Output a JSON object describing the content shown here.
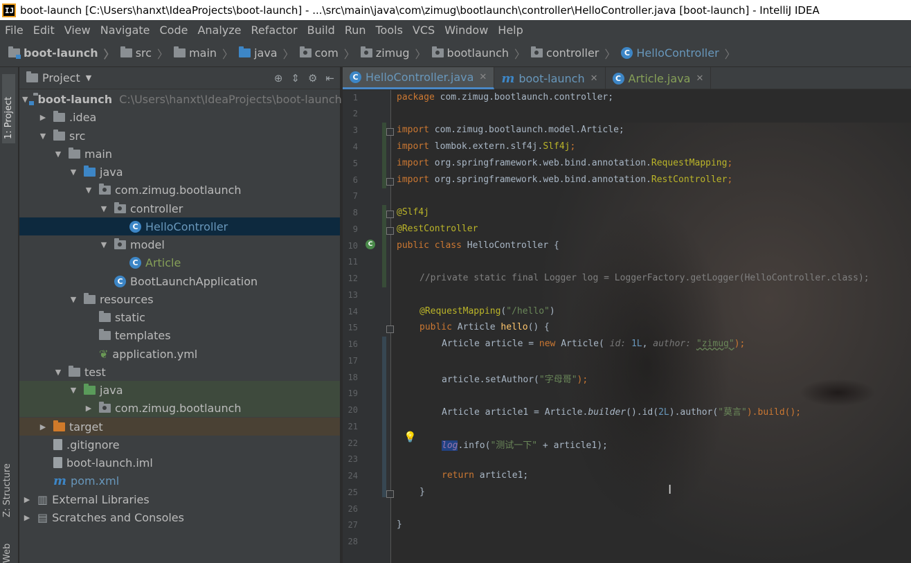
{
  "window": {
    "title": "boot-launch [C:\\Users\\hanxt\\IdeaProjects\\boot-launch] - ...\\src\\main\\java\\com\\zimug\\bootlaunch\\controller\\HelloController.java [boot-launch] - IntelliJ IDEA",
    "app_icon": "IJ"
  },
  "menu": [
    "File",
    "Edit",
    "View",
    "Navigate",
    "Code",
    "Analyze",
    "Refactor",
    "Build",
    "Run",
    "Tools",
    "VCS",
    "Window",
    "Help"
  ],
  "breadcrumb": [
    "boot-launch",
    "src",
    "main",
    "java",
    "com",
    "zimug",
    "bootlaunch",
    "controller",
    "HelloController"
  ],
  "tool_windows": {
    "project_tab": "1: Project",
    "structure_tab": "Z: Structure",
    "web_tab": "Web"
  },
  "project_panel": {
    "title": "Project",
    "tree": [
      {
        "label": "boot-launch",
        "path": "C:\\Users\\hanxt\\IdeaProjects\\boot-launch"
      },
      {
        "label": ".idea"
      },
      {
        "label": "src"
      },
      {
        "label": "main"
      },
      {
        "label": "java"
      },
      {
        "label": "com.zimug.bootlaunch"
      },
      {
        "label": "controller"
      },
      {
        "label": "HelloController"
      },
      {
        "label": "model"
      },
      {
        "label": "Article"
      },
      {
        "label": "BootLaunchApplication"
      },
      {
        "label": "resources"
      },
      {
        "label": "static"
      },
      {
        "label": "templates"
      },
      {
        "label": "application.yml"
      },
      {
        "label": "test"
      },
      {
        "label": "java"
      },
      {
        "label": "com.zimug.bootlaunch"
      },
      {
        "label": "target"
      },
      {
        "label": ".gitignore"
      },
      {
        "label": "boot-launch.iml"
      },
      {
        "label": "pom.xml"
      },
      {
        "label": "External Libraries"
      },
      {
        "label": "Scratches and Consoles"
      }
    ]
  },
  "editor_tabs": [
    {
      "label": "HelloController.java",
      "active": true
    },
    {
      "label": "boot-launch",
      "active": false
    },
    {
      "label": "Article.java",
      "active": false
    }
  ],
  "line_numbers": [
    "1",
    "2",
    "3",
    "4",
    "5",
    "6",
    "7",
    "8",
    "9",
    "10",
    "11",
    "12",
    "13",
    "14",
    "15",
    "16",
    "17",
    "18",
    "19",
    "20",
    "21",
    "22",
    "23",
    "24",
    "25",
    "26",
    "27",
    "28"
  ],
  "code": {
    "l1_kw": "package",
    "l1_rest": " com.zimug.bootlaunch.controller;",
    "l3_kw": "import",
    "l3_rest": " com.zimug.bootlaunch.model.Article;",
    "l4_kw": "import",
    "l4_rest": " lombok.extern.slf4j.",
    "l4_cls": "Slf4j",
    "l4_end": ";",
    "l5_kw": "import",
    "l5_rest": " org.springframework.web.bind.annotation.",
    "l5_cls": "RequestMapping",
    "l5_end": ";",
    "l6_kw": "import",
    "l6_rest": " org.springframework.web.bind.annotation.",
    "l6_cls": "RestController",
    "l6_end": ";",
    "l8_an": "@Slf4j",
    "l9_an": "@RestController",
    "l10_kw": "public class",
    "l10_rest": " HelloController {",
    "l12_cm": "//private static final Logger log = LoggerFactory.getLogger(HelloController.class);",
    "l14_an": "@RequestMapping",
    "l14_p1": "(",
    "l14_str": "\"/hello\"",
    "l14_p2": ")",
    "l15_kw": "public",
    "l15_rest": " Article ",
    "l15_m": "hello",
    "l15_end": "() {",
    "l16_a": "Article article = ",
    "l16_kw": "new",
    "l16_b": " Article(",
    "l16_hint1": " id: ",
    "l16_num": "1L",
    "l16_c": ",",
    "l16_hint2": " author: ",
    "l16_str": "\"zimug\"",
    "l16_end": ");",
    "l18_a": "article.setAuthor(",
    "l18_str": "\"字母哥\"",
    "l18_end": ");",
    "l20_a": "Article article1 = Article.",
    "l20_m": "builder",
    "l20_b": "().id(",
    "l20_num": "2L",
    "l20_c": ").author(",
    "l20_str": "\"莫言\"",
    "l20_end": ").build();",
    "l22_var": "log",
    "l22_a": ".info(",
    "l22_str": "\"测试一下\"",
    "l22_end": " + article1);",
    "l24_kw": "return",
    "l24_rest": " article1;",
    "l25": "}",
    "l27": "}"
  }
}
